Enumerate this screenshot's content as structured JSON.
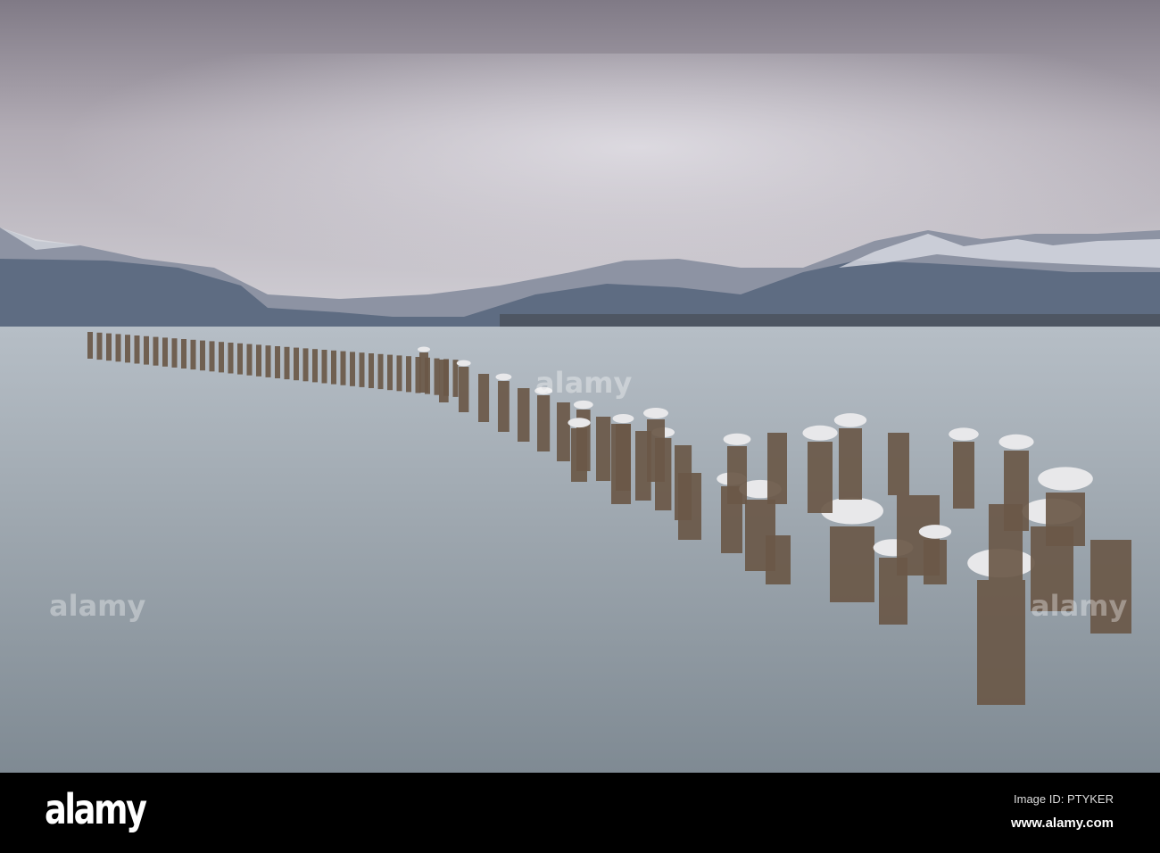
{
  "image": {
    "subject": "pier-posts-with-seagulls",
    "colors": {
      "sky": "#b9b3bd",
      "water": "#9aa4ac",
      "mountains": "#5c6b80",
      "wood": "#6a5848"
    }
  },
  "watermark": {
    "text": "alamy"
  },
  "footer": {
    "logo": "alamy",
    "image_id": "Image ID: PTYKER",
    "url": "www.alamy.com"
  }
}
